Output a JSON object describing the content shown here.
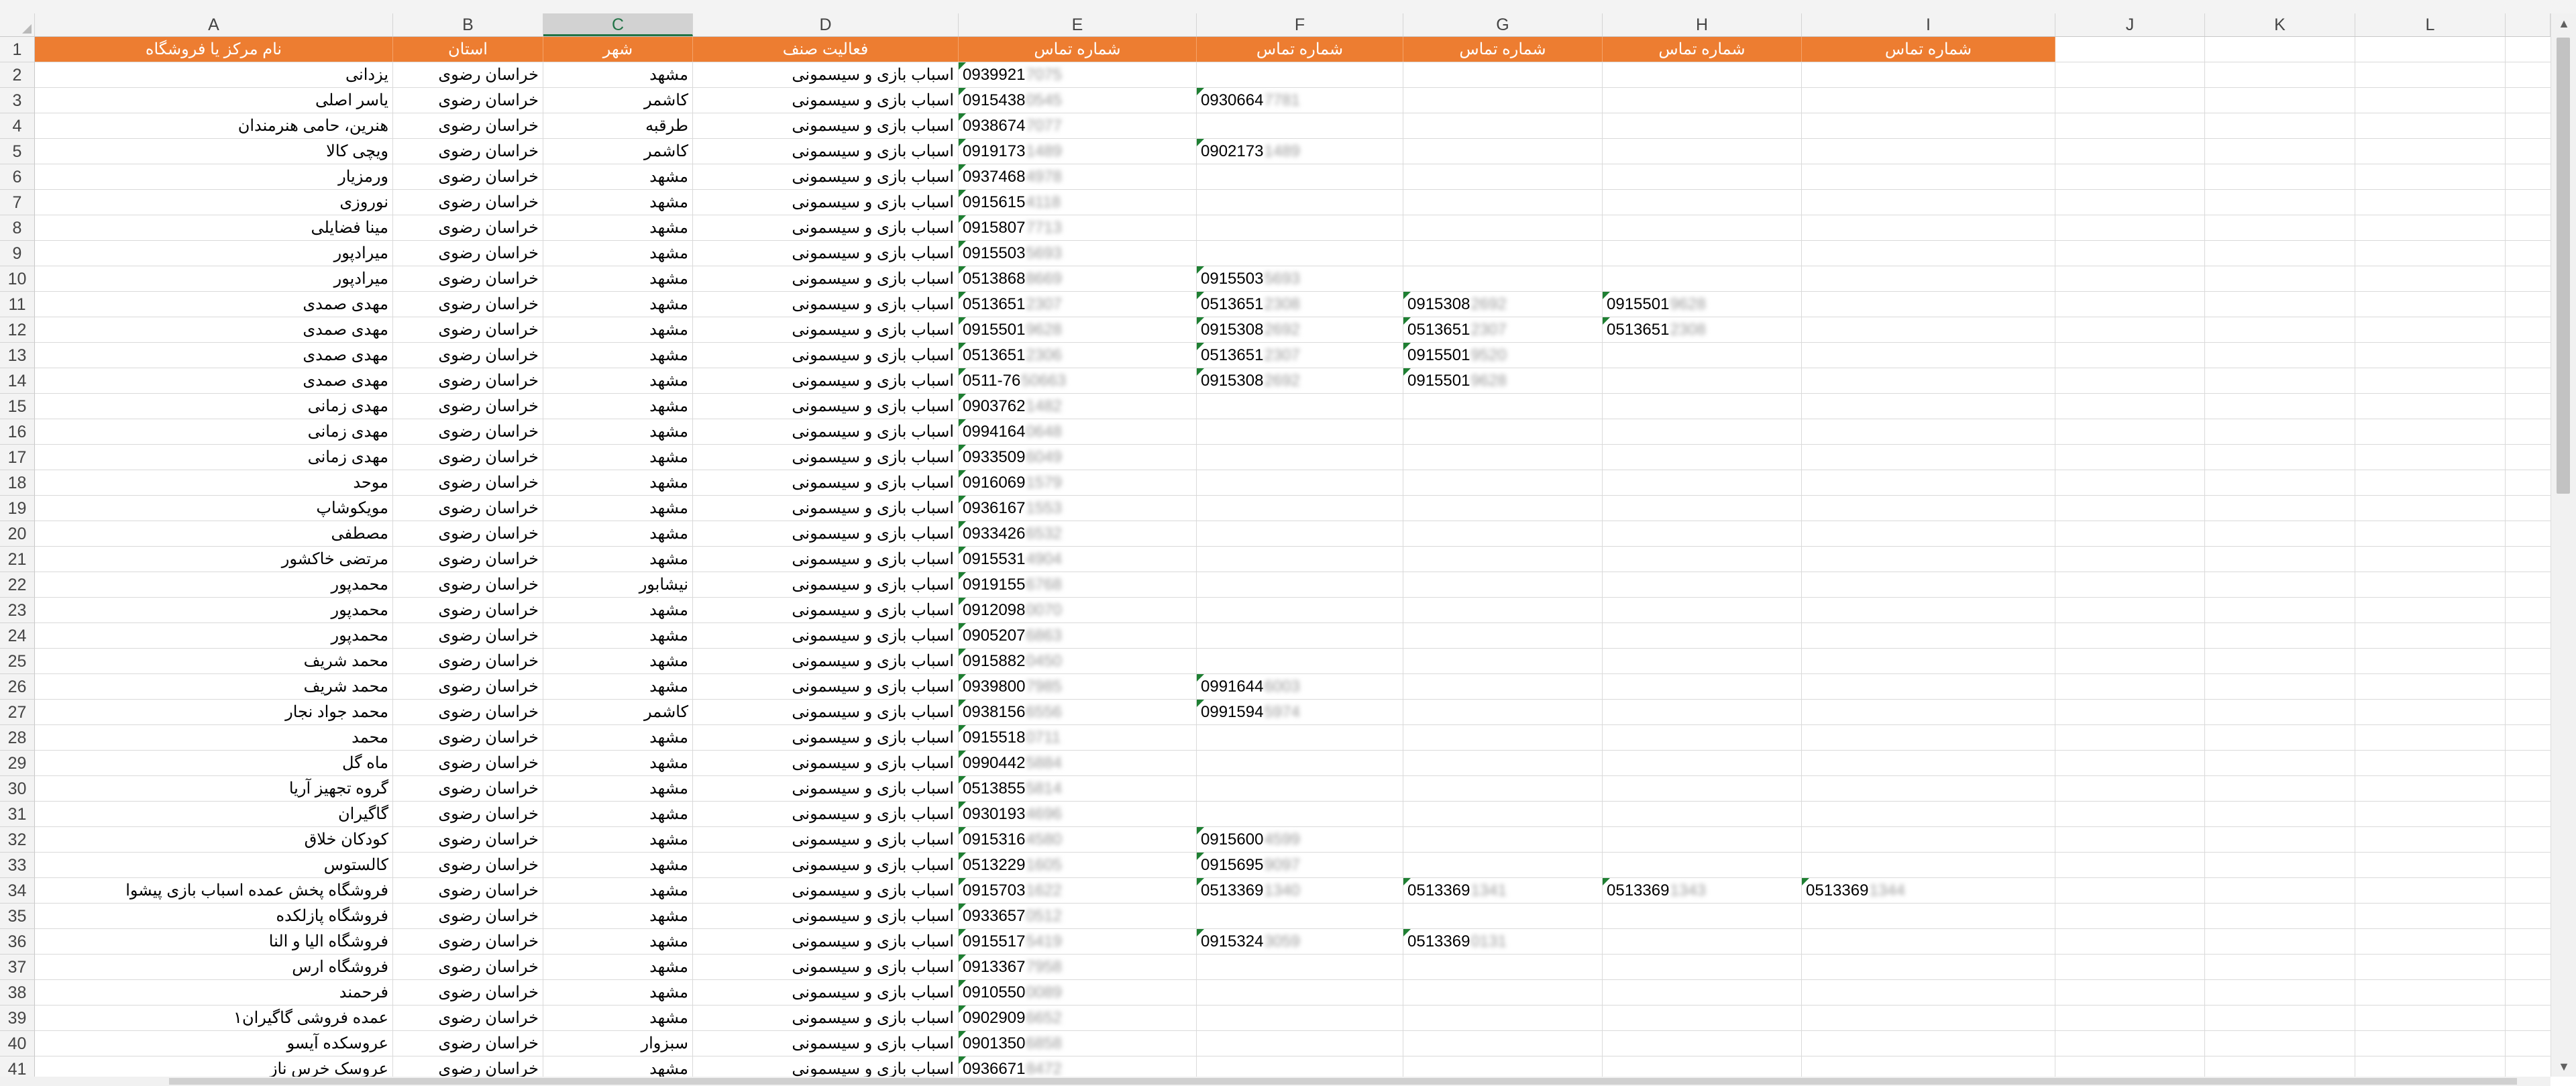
{
  "sheet": {
    "columns": [
      "A",
      "B",
      "C",
      "D",
      "E",
      "F",
      "G",
      "H",
      "I",
      "J",
      "K",
      "L"
    ],
    "selected_column": "C",
    "header_row": {
      "row_number": "1",
      "cells": [
        "نام مرکز یا فروشگاه",
        "استان",
        "شهر",
        "فعالیت صنف",
        "شماره تماس",
        "شماره تماس",
        "شماره تماس",
        "شماره تماس",
        "شماره تماس",
        "",
        "",
        ""
      ]
    },
    "rows": [
      {
        "n": "2",
        "name": "یزدانی",
        "province": "خراسان رضوی",
        "city": "مشهد",
        "activity": "اسباب بازی و سیسمونی",
        "phones": [
          {
            "v": "0939921",
            "m": "7075"
          }
        ]
      },
      {
        "n": "3",
        "name": "یاسر اصلی",
        "province": "خراسان رضوی",
        "city": "کاشمر",
        "activity": "اسباب بازی و سیسمونی",
        "phones": [
          {
            "v": "0915438",
            "m": "0545"
          },
          {
            "v": "0930664",
            "m": "7781"
          }
        ]
      },
      {
        "n": "4",
        "name": "هنرین، حامی هنرمندان",
        "province": "خراسان رضوی",
        "city": "طرقبه",
        "activity": "اسباب بازی و سیسمونی",
        "phones": [
          {
            "v": "0938674",
            "m": "7077"
          }
        ]
      },
      {
        "n": "5",
        "name": "ویچی کالا",
        "province": "خراسان رضوی",
        "city": "کاشمر",
        "activity": "اسباب بازی و سیسمونی",
        "phones": [
          {
            "v": "0919173",
            "m": "1489"
          },
          {
            "v": "0902173",
            "m": "1489"
          }
        ]
      },
      {
        "n": "6",
        "name": "ورمزیار",
        "province": "خراسان رضوی",
        "city": "مشهد",
        "activity": "اسباب بازی و سیسمونی",
        "phones": [
          {
            "v": "0937468",
            "m": "4978"
          }
        ]
      },
      {
        "n": "7",
        "name": "نوروزی",
        "province": "خراسان رضوی",
        "city": "مشهد",
        "activity": "اسباب بازی و سیسمونی",
        "phones": [
          {
            "v": "0915615",
            "m": "4118"
          }
        ]
      },
      {
        "n": "8",
        "name": "مینا فضایلی",
        "province": "خراسان رضوی",
        "city": "مشهد",
        "activity": "اسباب بازی و سیسمونی",
        "phones": [
          {
            "v": "0915807",
            "m": "7713"
          }
        ]
      },
      {
        "n": "9",
        "name": "میرادپور",
        "province": "خراسان رضوی",
        "city": "مشهد",
        "activity": "اسباب بازی و سیسمونی",
        "phones": [
          {
            "v": "0915503",
            "m": "5693"
          }
        ]
      },
      {
        "n": "10",
        "name": "میرادپور",
        "province": "خراسان رضوی",
        "city": "مشهد",
        "activity": "اسباب بازی و سیسمونی",
        "phones": [
          {
            "v": "0513868",
            "m": "8669"
          },
          {
            "v": "0915503",
            "m": "5693"
          }
        ]
      },
      {
        "n": "11",
        "name": "مهدی صمدی",
        "province": "خراسان رضوی",
        "city": "مشهد",
        "activity": "اسباب بازی و سیسمونی",
        "phones": [
          {
            "v": "0513651",
            "m": "2307"
          },
          {
            "v": "0513651",
            "m": "2308"
          },
          {
            "v": "0915308",
            "m": "2692"
          },
          {
            "v": "0915501",
            "m": "9628"
          }
        ]
      },
      {
        "n": "12",
        "name": "مهدی صمدی",
        "province": "خراسان رضوی",
        "city": "مشهد",
        "activity": "اسباب بازی و سیسمونی",
        "phones": [
          {
            "v": "0915501",
            "m": "9628"
          },
          {
            "v": "0915308",
            "m": "2692"
          },
          {
            "v": "0513651",
            "m": "2307"
          },
          {
            "v": "0513651",
            "m": "2308"
          }
        ]
      },
      {
        "n": "13",
        "name": "مهدی صمدی",
        "province": "خراسان رضوی",
        "city": "مشهد",
        "activity": "اسباب بازی و سیسمونی",
        "phones": [
          {
            "v": "0513651",
            "m": "2306"
          },
          {
            "v": "0513651",
            "m": "2307"
          },
          {
            "v": "0915501",
            "m": "9520"
          }
        ]
      },
      {
        "n": "14",
        "name": "مهدی صمدی",
        "province": "خراسان رضوی",
        "city": "مشهد",
        "activity": "اسباب بازی و سیسمونی",
        "phones": [
          {
            "v": "0511-76",
            "m": "50663"
          },
          {
            "v": "0915308",
            "m": "2692"
          },
          {
            "v": "0915501",
            "m": "9628"
          }
        ]
      },
      {
        "n": "15",
        "name": "مهدی زمانی",
        "province": "خراسان رضوی",
        "city": "مشهد",
        "activity": "اسباب بازی و سیسمونی",
        "phones": [
          {
            "v": "0903762",
            "m": "1482"
          }
        ]
      },
      {
        "n": "16",
        "name": "مهدی زمانی",
        "province": "خراسان رضوی",
        "city": "مشهد",
        "activity": "اسباب بازی و سیسمونی",
        "phones": [
          {
            "v": "0994164",
            "m": "0648"
          }
        ]
      },
      {
        "n": "17",
        "name": "مهدی زمانی",
        "province": "خراسان رضوی",
        "city": "مشهد",
        "activity": "اسباب بازی و سیسمونی",
        "phones": [
          {
            "v": "0933509",
            "m": "6049"
          }
        ]
      },
      {
        "n": "18",
        "name": "موحد",
        "province": "خراسان رضوی",
        "city": "مشهد",
        "activity": "اسباب بازی و سیسمونی",
        "phones": [
          {
            "v": "0916069",
            "m": "1579"
          }
        ]
      },
      {
        "n": "19",
        "name": "مویکوشاپ",
        "province": "خراسان رضوی",
        "city": "مشهد",
        "activity": "اسباب بازی و سیسمونی",
        "phones": [
          {
            "v": "0936167",
            "m": "1553"
          }
        ]
      },
      {
        "n": "20",
        "name": "مصطفی",
        "province": "خراسان رضوی",
        "city": "مشهد",
        "activity": "اسباب بازی و سیسمونی",
        "phones": [
          {
            "v": "0933426",
            "m": "6532"
          }
        ]
      },
      {
        "n": "21",
        "name": "مرتضی خاکشور",
        "province": "خراسان رضوی",
        "city": "مشهد",
        "activity": "اسباب بازی و سیسمونی",
        "phones": [
          {
            "v": "0915531",
            "m": "4904"
          }
        ]
      },
      {
        "n": "22",
        "name": "محمدپور",
        "province": "خراسان رضوی",
        "city": "نیشابور",
        "activity": "اسباب بازی و سیسمونی",
        "phones": [
          {
            "v": "0919155",
            "m": "6768"
          }
        ]
      },
      {
        "n": "23",
        "name": "محمدپور",
        "province": "خراسان رضوی",
        "city": "مشهد",
        "activity": "اسباب بازی و سیسمونی",
        "phones": [
          {
            "v": "0912098",
            "m": "0070"
          }
        ]
      },
      {
        "n": "24",
        "name": "محمدپور",
        "province": "خراسان رضوی",
        "city": "مشهد",
        "activity": "اسباب بازی و سیسمونی",
        "phones": [
          {
            "v": "0905207",
            "m": "6863"
          }
        ]
      },
      {
        "n": "25",
        "name": "محمد شریف",
        "province": "خراسان رضوی",
        "city": "مشهد",
        "activity": "اسباب بازی و سیسمونی",
        "phones": [
          {
            "v": "0915882",
            "m": "0450"
          }
        ]
      },
      {
        "n": "26",
        "name": "محمد شریف",
        "province": "خراسان رضوی",
        "city": "مشهد",
        "activity": "اسباب بازی و سیسمونی",
        "phones": [
          {
            "v": "0939800",
            "m": "7985"
          },
          {
            "v": "0991644",
            "m": "6003"
          }
        ]
      },
      {
        "n": "27",
        "name": "محمد جواد نجار",
        "province": "خراسان رضوی",
        "city": "کاشمر",
        "activity": "اسباب بازی و سیسمونی",
        "phones": [
          {
            "v": "0938156",
            "m": "6556"
          },
          {
            "v": "0991594",
            "m": "5974"
          }
        ]
      },
      {
        "n": "28",
        "name": "محمد",
        "province": "خراسان رضوی",
        "city": "مشهد",
        "activity": "اسباب بازی و سیسمونی",
        "phones": [
          {
            "v": "0915518",
            "m": "0711"
          }
        ]
      },
      {
        "n": "29",
        "name": "ماه گل",
        "province": "خراسان رضوی",
        "city": "مشهد",
        "activity": "اسباب بازی و سیسمونی",
        "phones": [
          {
            "v": "0990442",
            "m": "5884"
          }
        ]
      },
      {
        "n": "30",
        "name": "گروه تجهیز آریا",
        "province": "خراسان رضوی",
        "city": "مشهد",
        "activity": "اسباب بازی و سیسمونی",
        "phones": [
          {
            "v": "0513855",
            "m": "5814"
          }
        ]
      },
      {
        "n": "31",
        "name": "گاگیران",
        "province": "خراسان رضوی",
        "city": "مشهد",
        "activity": "اسباب بازی و سیسمونی",
        "phones": [
          {
            "v": "0930193",
            "m": "4696"
          }
        ]
      },
      {
        "n": "32",
        "name": "کودکان خلاق",
        "province": "خراسان رضوی",
        "city": "مشهد",
        "activity": "اسباب بازی و سیسمونی",
        "phones": [
          {
            "v": "0915316",
            "m": "4580"
          },
          {
            "v": "0915600",
            "m": "4599"
          }
        ]
      },
      {
        "n": "33",
        "name": "کالستوس",
        "province": "خراسان رضوی",
        "city": "مشهد",
        "activity": "اسباب بازی و سیسمونی",
        "phones": [
          {
            "v": "0513229",
            "m": "1605"
          },
          {
            "v": "0915695",
            "m": "9097"
          }
        ]
      },
      {
        "n": "34",
        "name": "فروشگاه پخش عمده اسباب بازی پیشوا",
        "province": "خراسان رضوی",
        "city": "مشهد",
        "activity": "اسباب بازی و سیسمونی",
        "phones": [
          {
            "v": "0915703",
            "m": "1622"
          },
          {
            "v": "0513369",
            "m": "1340"
          },
          {
            "v": "0513369",
            "m": "1341"
          },
          {
            "v": "0513369",
            "m": "1343"
          },
          {
            "v": "0513369",
            "m": "1344"
          }
        ]
      },
      {
        "n": "35",
        "name": "فروشگاه پازلکده",
        "province": "خراسان رضوی",
        "city": "مشهد",
        "activity": "اسباب بازی و سیسمونی",
        "phones": [
          {
            "v": "0933657",
            "m": "0512"
          }
        ]
      },
      {
        "n": "36",
        "name": "فروشگاه الیا و النا",
        "province": "خراسان رضوی",
        "city": "مشهد",
        "activity": "اسباب بازی و سیسمونی",
        "phones": [
          {
            "v": "0915517",
            "m": "5419"
          },
          {
            "v": "0915324",
            "m": "3059"
          },
          {
            "v": "0513369",
            "m": "0131"
          }
        ]
      },
      {
        "n": "37",
        "name": "فروشگاه ارس",
        "province": "خراسان رضوی",
        "city": "مشهد",
        "activity": "اسباب بازی و سیسمونی",
        "phones": [
          {
            "v": "0913367",
            "m": "7958"
          }
        ]
      },
      {
        "n": "38",
        "name": "فرحمند",
        "province": "خراسان رضوی",
        "city": "مشهد",
        "activity": "اسباب بازی و سیسمونی",
        "phones": [
          {
            "v": "0910550",
            "m": "0089"
          }
        ]
      },
      {
        "n": "39",
        "name": "عمده فروشی گاگیران۱",
        "province": "خراسان رضوی",
        "city": "مشهد",
        "activity": "اسباب بازی و سیسمونی",
        "phones": [
          {
            "v": "0902909",
            "m": "6652"
          }
        ]
      },
      {
        "n": "40",
        "name": "عروسکده آیسو",
        "province": "خراسان رضوی",
        "city": "سبزوار",
        "activity": "اسباب بازی و سیسمونی",
        "phones": [
          {
            "v": "0901350",
            "m": "6858"
          }
        ]
      },
      {
        "n": "41",
        "name": "عروسک خرس ناز",
        "province": "خراسان رضوی",
        "city": "مشهد",
        "activity": "اسباب بازی و سیسمونی",
        "phones": [
          {
            "v": "0936671",
            "m": "8472"
          }
        ]
      }
    ]
  },
  "colors": {
    "header_fill": "#ed7d31",
    "header_text": "#ffffff",
    "note_triangle": "#1e7f32",
    "selected_header": "#217346"
  },
  "icons": {
    "scroll_up": "arrow-up-icon",
    "scroll_down": "arrow-down-icon",
    "select_all": "select-all-triangle-icon",
    "cell_note": "green-triangle-indicator"
  }
}
